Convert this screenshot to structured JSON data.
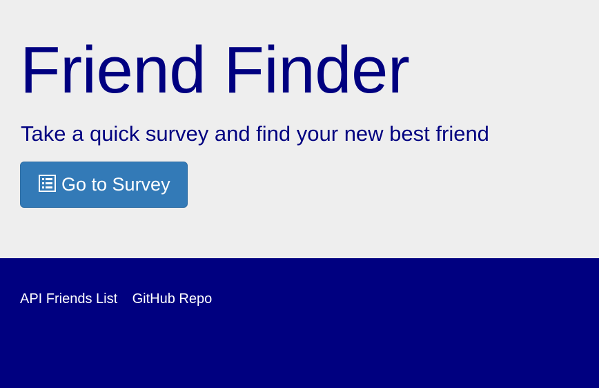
{
  "header": {
    "title": "Friend Finder",
    "subtitle": "Take a quick survey and find your new best friend",
    "survey_button": {
      "label": "Go to Survey",
      "icon": "list-alt-icon"
    }
  },
  "footer": {
    "links": [
      {
        "label": "API Friends List"
      },
      {
        "label": "GitHub Repo"
      }
    ]
  },
  "colors": {
    "background": "#eeeeee",
    "brand_navy": "#000080",
    "button_blue": "#337ab7"
  }
}
